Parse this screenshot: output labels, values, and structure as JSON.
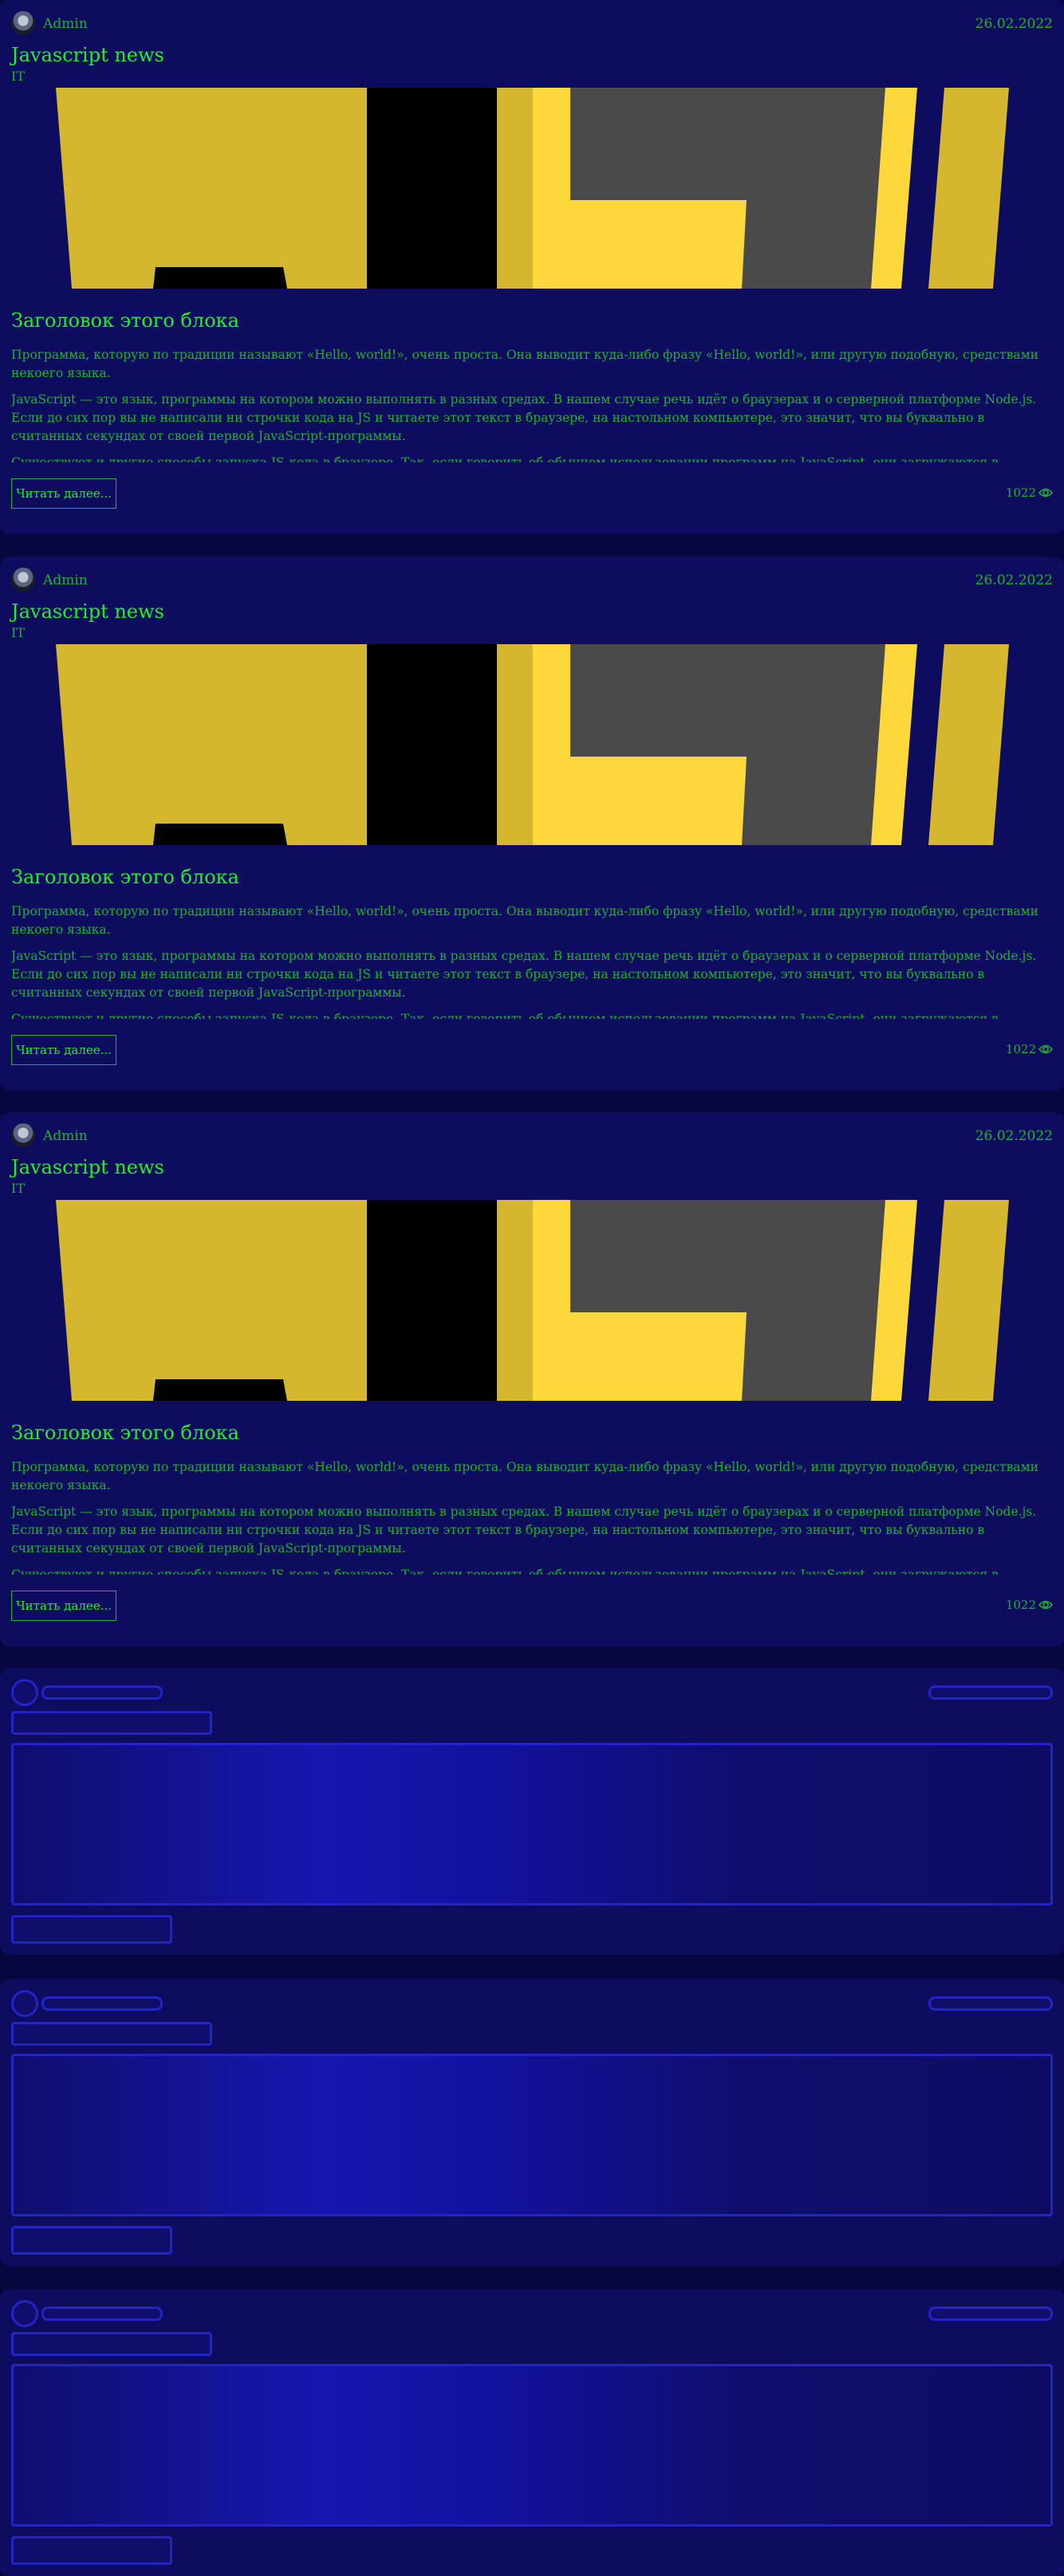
{
  "posts": [
    {
      "author": "Admin",
      "date": "26.02.2022",
      "title": "Javascript news",
      "category": "IT",
      "subtitle": "Заголовок этого блока",
      "paragraphs": [
        "Программа, которую по традиции называют «Hello, world!», очень проста. Она выводит куда-либо фразу «Hello, world!», или другую подобную, средствами некоего языка.",
        "JavaScript — это язык, программы на котором можно выполнять в разных средах. В нашем случае речь идёт о браузерах и о серверной платформе Node.js. Если до сих пор вы не написали ни строчки кода на JS и читаете этот текст в браузере, на настольном компьютере, это значит, что вы буквально в считанных секундах от своей первой JavaScript-программы.",
        "Существуют и другие способы запуска JS-кода в браузере. Так, если говорить об обычном использовании программ на JavaScript, они загружаются в браузер для обеспечения работы веб-страниц. Как правило, код оформляют в виде отдельных файлов с расширением .js, которые подключают к веб-страницам, но программный код можно включать и непосредственно в код страницы. Всё это делается с помощью тега <script>. Когда браузер обнаруживает такой код, он выполняет его. Подробности о теге script можно посмотреть на сайте w3school.com. В"
      ],
      "read_more": "Читать далее...",
      "views": "1022"
    },
    {
      "author": "Admin",
      "date": "26.02.2022",
      "title": "Javascript news",
      "category": "IT",
      "subtitle": "Заголовок этого блока",
      "paragraphs": [
        "Программа, которую по традиции называют «Hello, world!», очень проста. Она выводит куда-либо фразу «Hello, world!», или другую подобную, средствами некоего языка.",
        "JavaScript — это язык, программы на котором можно выполнять в разных средах. В нашем случае речь идёт о браузерах и о серверной платформе Node.js. Если до сих пор вы не написали ни строчки кода на JS и читаете этот текст в браузере, на настольном компьютере, это значит, что вы буквально в считанных секундах от своей первой JavaScript-программы.",
        "Существуют и другие способы запуска JS-кода в браузере. Так, если говорить об обычном использовании программ на JavaScript, они загружаются в браузер для обеспечения работы веб-страниц. Как правило, код оформляют в виде отдельных файлов с расширением .js, которые подключают к веб-страницам, но программный код можно включать и непосредственно в код страницы. Всё это делается с помощью тега <script>. Когда браузер обнаруживает такой код, он выполняет его. Подробности о теге script можно посмотреть на сайте w3school.com. В"
      ],
      "read_more": "Читать далее...",
      "views": "1022"
    },
    {
      "author": "Admin",
      "date": "26.02.2022",
      "title": "Javascript news",
      "category": "IT",
      "subtitle": "Заголовок этого блока",
      "paragraphs": [
        "Программа, которую по традиции называют «Hello, world!», очень проста. Она выводит куда-либо фразу «Hello, world!», или другую подобную, средствами некоего языка.",
        "JavaScript — это язык, программы на котором можно выполнять в разных средах. В нашем случае речь идёт о браузерах и о серверной платформе Node.js. Если до сих пор вы не написали ни строчки кода на JS и читаете этот текст в браузере, на настольном компьютере, это значит, что вы буквально в считанных секундах от своей первой JavaScript-программы.",
        "Существуют и другие способы запуска JS-кода в браузере. Так, если говорить об обычном использовании программ на JavaScript, они загружаются в браузер для обеспечения работы веб-страниц. Как правило, код оформляют в виде отдельных файлов с расширением .js, которые подключают к веб-страницам, но программный код можно включать и непосредственно в код страницы. Всё это делается с помощью тега <script>. Когда браузер обнаруживает такой код, он выполняет его. Подробности о теге script можно посмотреть на сайте w3school.com. В"
      ],
      "read_more": "Читать далее...",
      "views": "1022"
    }
  ],
  "icons": {
    "views": "eye-icon",
    "avatar": "user-avatar"
  },
  "colors": {
    "background": "#07063f",
    "card": "#0d0c5e",
    "text": "#1fb22c",
    "heading": "#22ee2e",
    "skeleton": "#2323c8",
    "js_yellow": "#d4b72f"
  },
  "skeleton_cards": 3
}
